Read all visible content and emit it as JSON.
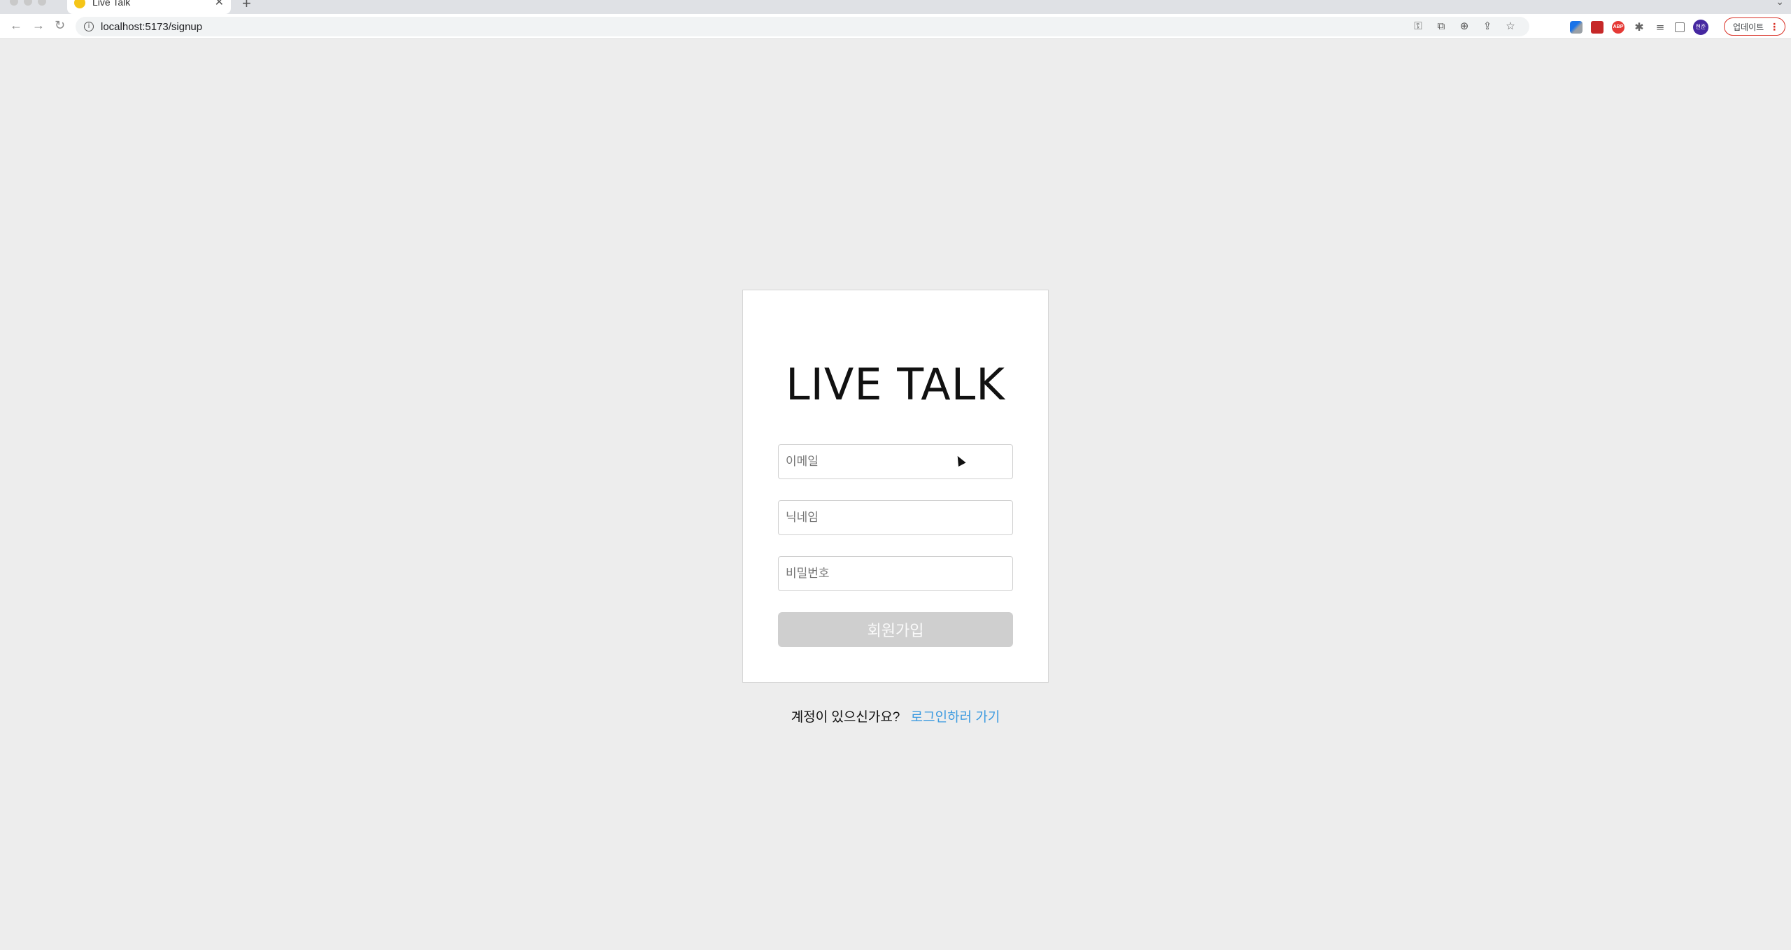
{
  "browser": {
    "tab_title": "Live Talk",
    "tab_close": "✕",
    "new_tab": "+",
    "tab_list": "⌄",
    "back": "←",
    "forward": "→",
    "reload": "↻",
    "info": "i",
    "url": "localhost:5173/signup",
    "omnibox_icons": [
      "key-icon",
      "translate-icon",
      "zoom-icon",
      "share-icon",
      "bookmark-star-icon"
    ],
    "profile_initials": "현준",
    "update_label": "업데이트",
    "update_menu": "⋮"
  },
  "page": {
    "logo": "LIVE TALK",
    "email_placeholder": "이메일",
    "nickname_placeholder": "닉네임",
    "password_placeholder": "비밀번호",
    "submit_label": "회원가입",
    "have_account_text": "계정이 있으신가요?",
    "login_link_text": "로그인하러 가기"
  },
  "colors": {
    "page_background": "#ededed",
    "card_background": "#ffffff",
    "button_disabled": "#cfcfcf",
    "link": "#3d9be0",
    "update_accent": "#d93025"
  }
}
